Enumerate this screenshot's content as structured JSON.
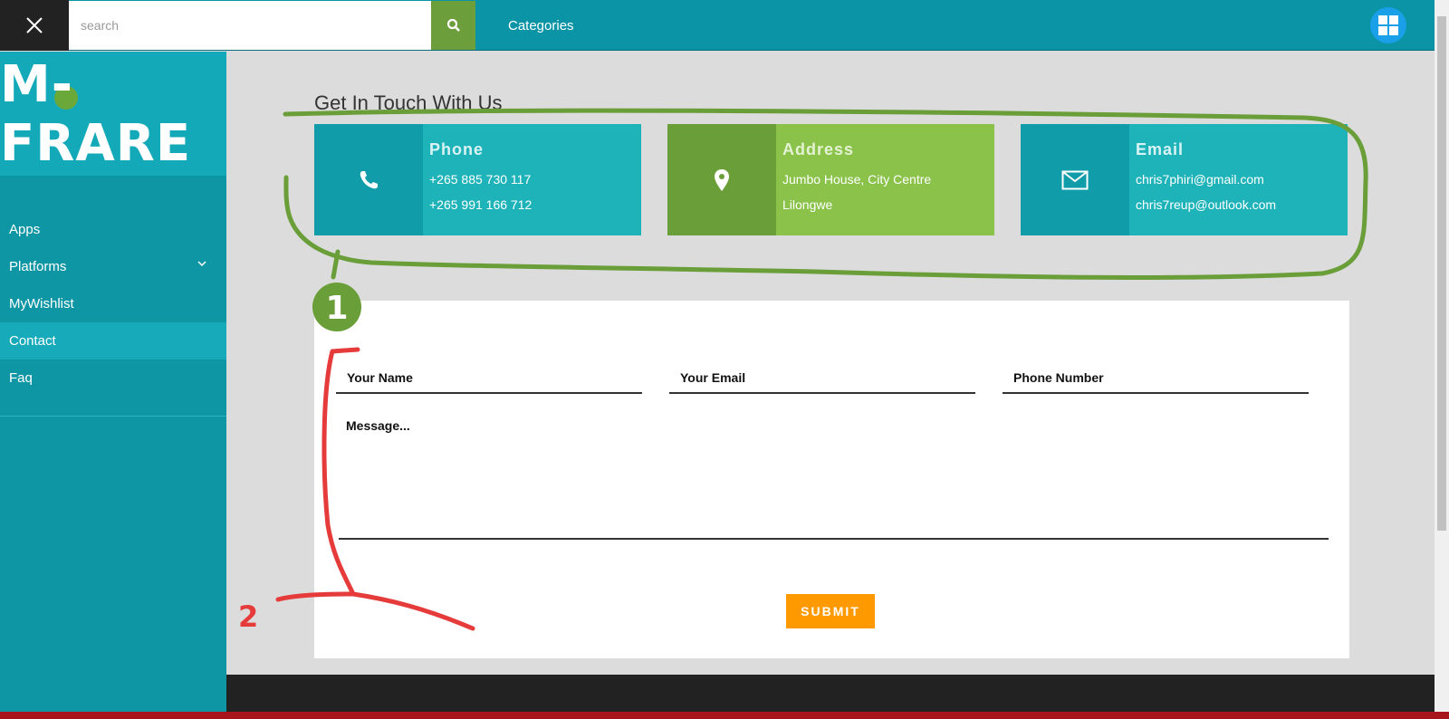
{
  "search": {
    "placeholder": "search"
  },
  "header": {
    "categories_label": "Categories"
  },
  "logo": {
    "text": "M-FRARE"
  },
  "sidebar": {
    "items": [
      {
        "label": "Apps"
      },
      {
        "label": "Platforms"
      },
      {
        "label": "MyWishlist"
      },
      {
        "label": "Contact"
      },
      {
        "label": "Faq"
      }
    ]
  },
  "contact": {
    "title": "Get In Touch With Us",
    "phone": {
      "title": "Phone",
      "line1": "+265 885 730 117",
      "line2": "+265 991 166 712"
    },
    "address": {
      "title": "Address",
      "line1": "Jumbo House, City Centre",
      "line2": "Lilongwe"
    },
    "email": {
      "title": "Email",
      "line1": "chris7phiri@gmail.com",
      "line2": "chris7reup@outlook.com"
    }
  },
  "form": {
    "name_placeholder": "Your Name",
    "email_placeholder": "Your Email",
    "phone_placeholder": "Phone Number",
    "message_placeholder": "Message...",
    "submit_label": "SUBMIT"
  },
  "annotations": {
    "marker1": "1",
    "marker2": "2"
  },
  "colors": {
    "topbar": "#0a94a5",
    "sidebar": "#0f96a5",
    "accent_green": "#6a9e39",
    "submit": "#ff9900",
    "annotation_green": "#6a9e39",
    "annotation_red": "#e63b3b"
  }
}
